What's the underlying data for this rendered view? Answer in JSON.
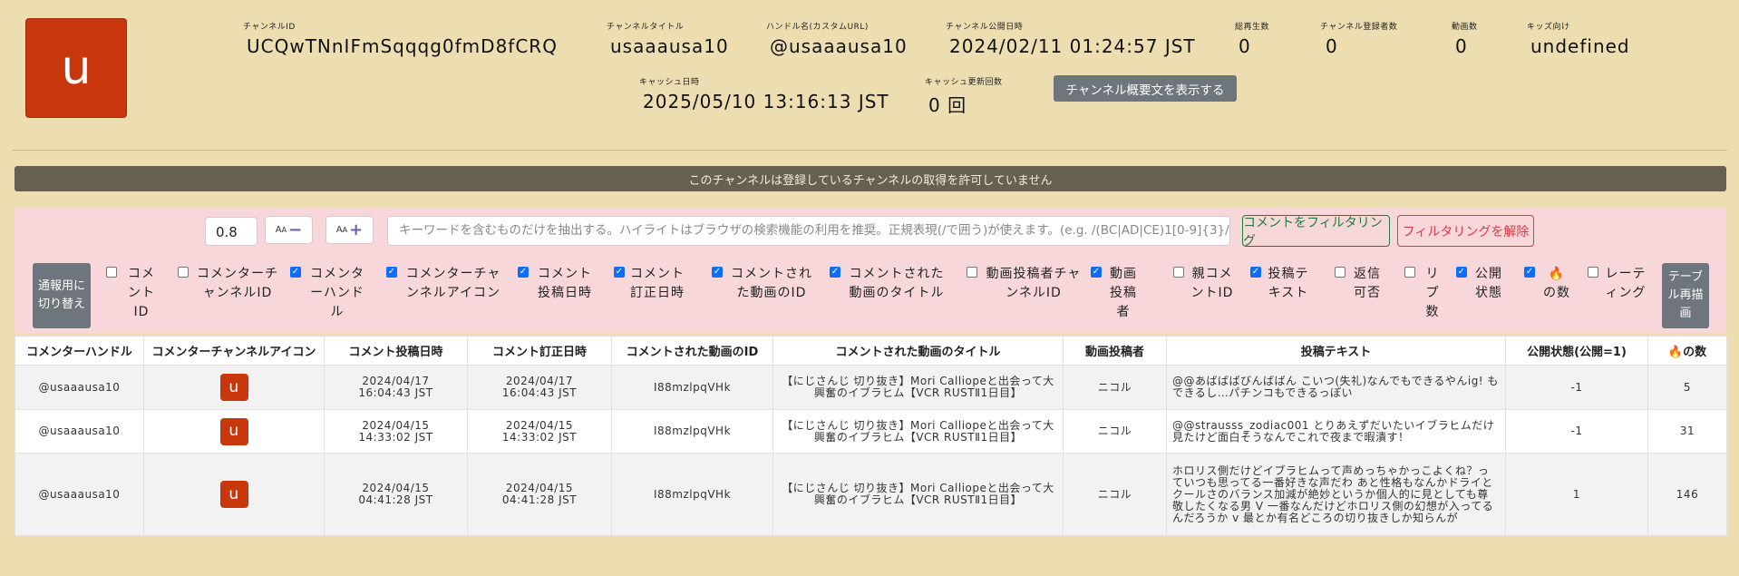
{
  "header": {
    "avatar_letter": "u",
    "channel_id_label": "チャンネルID",
    "channel_id": "UCQwTNnIFmSqqqg0fmD8fCRQ",
    "title_label": "チャンネルタイトル",
    "title": "usaaausa10",
    "handle_label": "ハンドル名(カスタムURL)",
    "handle": "@usaaausa10",
    "published_label": "チャンネル公開日時",
    "published": "2024/02/11 01:24:57 JST",
    "views_label": "総再生数",
    "views": "0",
    "subs_label": "チャンネル登録者数",
    "subs": "0",
    "videos_label": "動画数",
    "videos": "0",
    "kids_label": "キッズ向け",
    "kids": "undefined",
    "cache_label": "キャッシュ日時",
    "cache": "2025/05/10 13:16:13 JST",
    "cache_count_label": "キャッシュ更新回数",
    "cache_count": "0 回",
    "desc_button": "チャンネル概要文を表示する"
  },
  "banner": "このチャンネルは登録しているチャンネルの取得を許可していません",
  "toolbar": {
    "zoom": "0.8",
    "font_small_label": "A",
    "font_large_label": "A",
    "search_placeholder": "キーワードを含むものだけを抽出する。ハイライトはブラウザの検索機能の利用を推奨。正規表現(/で囲う)が使えます。(e.g. /(BC|AD|CE)1[0-9]{3}/)",
    "filter_button": "コメントをフィルタリング",
    "clear_button": "フィルタリングを解除",
    "toggle_button": "通報用に切り替え",
    "redraw_button": "テーブル再描画"
  },
  "columns_toggle": [
    {
      "label": "コメントID",
      "checked": false
    },
    {
      "label": "コメンターチャンネルID",
      "checked": false
    },
    {
      "label": "コメンターハンドル",
      "checked": true
    },
    {
      "label": "コメンターチャンネルアイコン",
      "checked": true
    },
    {
      "label": "コメント投稿日時",
      "checked": true
    },
    {
      "label": "コメント訂正日時",
      "checked": true
    },
    {
      "label": "コメントされた動画のID",
      "checked": true
    },
    {
      "label": "コメントされた動画のタイトル",
      "checked": true
    },
    {
      "label": "動画投稿者チャンネルID",
      "checked": false
    },
    {
      "label": "動画投稿者",
      "checked": true
    },
    {
      "label": "親コメントID",
      "checked": false
    },
    {
      "label": "投稿テキスト",
      "checked": true
    },
    {
      "label": "返信可否",
      "checked": false
    },
    {
      "label": "リプ数",
      "checked": false
    },
    {
      "label": "公開状態",
      "checked": true
    },
    {
      "label": "の数",
      "checked": true
    },
    {
      "label": "レーティング",
      "checked": false
    }
  ],
  "table": {
    "headers": [
      "コメンターハンドル",
      "コメンターチャンネルアイコン",
      "コメント投稿日時",
      "コメント訂正日時",
      "コメントされた動画のID",
      "コメントされた動画のタイトル",
      "動画投稿者",
      "投稿テキスト",
      "公開状態(公開=1)",
      "の数"
    ],
    "rows": [
      {
        "handle": "@usaaausa10",
        "icon": "u",
        "posted_date": "2024/04/17",
        "posted_time": "16:04:43 JST",
        "edited_date": "2024/04/17",
        "edited_time": "16:04:43 JST",
        "video_id": "I88mzlpqVHk",
        "video_title_1": "【にじさんじ 切り抜き】Mori Calliopeと出会って大",
        "video_title_2": "興奮のイブラヒム【VCR RUSTⅡ1日目】",
        "uploader": "ニコル",
        "text": "@@あばばばびんばばん こいつ(失礼)なんでもできるやんig! もできるし…パチンコもできるっぽい",
        "public": "-1",
        "count": "5"
      },
      {
        "handle": "@usaaausa10",
        "icon": "u",
        "posted_date": "2024/04/15",
        "posted_time": "14:33:02 JST",
        "edited_date": "2024/04/15",
        "edited_time": "14:33:02 JST",
        "video_id": "I88mzlpqVHk",
        "video_title_1": "【にじさんじ 切り抜き】Mori Calliopeと出会って大",
        "video_title_2": "興奮のイブラヒム【VCR RUSTⅡ1日目】",
        "uploader": "ニコル",
        "text": "@@strausss_zodiac001 とりあえずだいたいイブラヒムだけ見たけど面白そうなんでこれで夜まで暇潰す！",
        "public": "-1",
        "count": "31"
      },
      {
        "handle": "@usaaausa10",
        "icon": "u",
        "posted_date": "2024/04/15",
        "posted_time": "04:41:28 JST",
        "edited_date": "2024/04/15",
        "edited_time": "04:41:28 JST",
        "video_id": "I88mzlpqVHk",
        "video_title_1": "【にじさんじ 切り抜き】Mori Calliopeと出会って大",
        "video_title_2": "興奮のイブラヒム【VCR RUSTⅡ1日目】",
        "uploader": "ニコル",
        "text": "ホロリス側だけどイブラヒムって声めっちゃかっこよくね？っていつも思ってる一番好きな声だわ あと性格もなんかドライとクールさのバランス加減が絶妙というか個人的に見としても尊敬したくなる男 V 一番なんだけどホロリス側の幻想が入ってるんだろうか v 最とか有名どころの切り抜きしか知らんが",
        "public": "1",
        "count": "146"
      }
    ]
  },
  "colors": {
    "background": "#eddeb2",
    "avatar": "#c8380c",
    "banner": "#656050",
    "panel": "#f8d7da",
    "checkbox": "#0d6efd"
  }
}
